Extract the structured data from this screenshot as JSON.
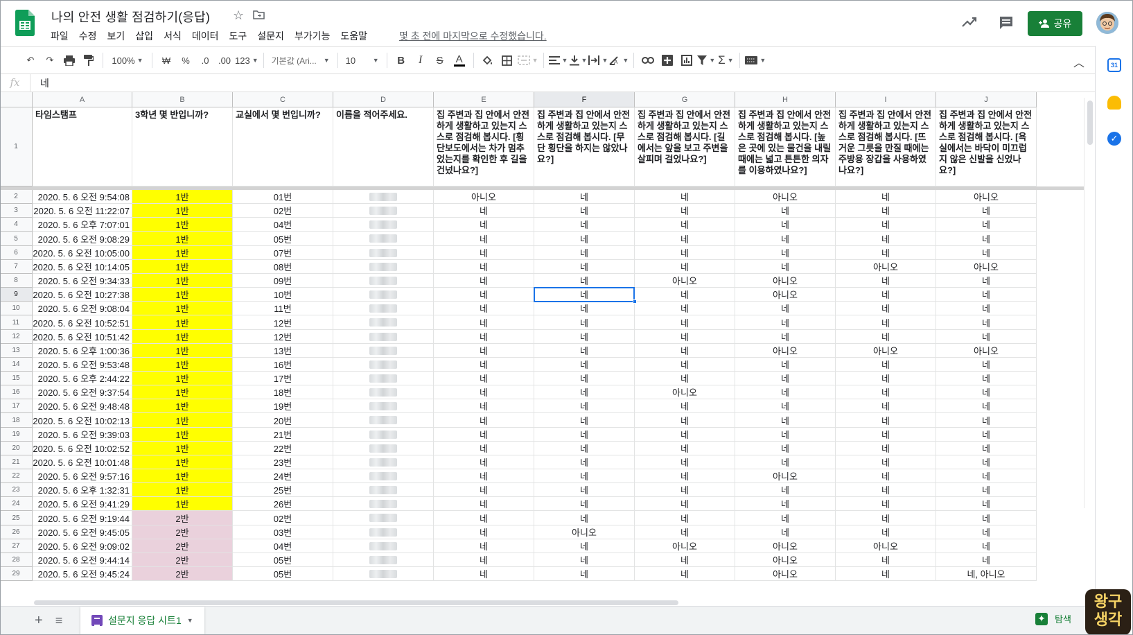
{
  "app": {
    "title": "나의 안전 생활 점검하기(응답)",
    "last_edit": "몇 초 전에 마지막으로 수정했습니다.",
    "share_label": "공유",
    "brand_color": "#188038"
  },
  "menu": [
    "파일",
    "수정",
    "보기",
    "삽입",
    "서식",
    "데이터",
    "도구",
    "설문지",
    "부가기능",
    "도움말"
  ],
  "toolbar": {
    "zoom": "100%",
    "currency": "₩",
    "percent": "%",
    "decimal_decrease": ".0",
    "decimal_increase": ".00",
    "format_more": "123",
    "font": "기본값 (Ari...",
    "font_size": "10"
  },
  "formula_bar": {
    "fx": "fx",
    "value": "네"
  },
  "columns": [
    "A",
    "B",
    "C",
    "D",
    "E",
    "F",
    "G",
    "H",
    "I",
    "J"
  ],
  "header_row": {
    "number": "1",
    "cells": [
      "타임스탬프",
      "3학년 몇 반입니까?",
      "교실에서 몇 번입니까?",
      "이름을 적어주세요.",
      "집 주변과 집 안에서 안전하게 생활하고 있는지 스스로 점검해 봅시다. [횡단보도에서는 차가 멈추었는지를 확인한 후 길을 건넜나요?]",
      "집 주변과 집 안에서 안전하게 생활하고 있는지 스스로 점검해 봅시다. [무단 횡단을 하지는 않았나요?]",
      "집 주변과 집 안에서 안전하게 생활하고 있는지 스스로 점검해 봅시다. [길에서는 앞을 보고 주변을 살피며 걸었나요?]",
      "집 주변과 집 안에서 안전하게 생활하고 있는지 스스로 점검해 봅시다. [높은 곳에 있는 물건을 내릴 때에는 넓고 튼튼한 의자를 이용하였나요?]",
      "집 주변과 집 안에서 안전하게 생활하고 있는지 스스로 점검해 봅시다. [뜨거운 그릇을 만질 때에는 주방용 장갑을 사용하였나요?]",
      "집 주변과 집 안에서 안전하게 생활하고 있는지 스스로 점검해 봅시다. [욕실에서는 바닥이 미끄럽지 않은 신발을 신었나요?]"
    ]
  },
  "class_colors": {
    "1반": "#ffff00",
    "2반": "#ead1dc"
  },
  "rows": [
    {
      "n": "2",
      "ts": "2020. 5. 6 오전 9:54:08",
      "cls": "1반",
      "no": "01번",
      "e": "아니오",
      "f": "네",
      "g": "네",
      "h": "아니오",
      "i": "네",
      "j": "아니오"
    },
    {
      "n": "3",
      "ts": "2020. 5. 6 오전 11:22:07",
      "cls": "1반",
      "no": "02번",
      "e": "네",
      "f": "네",
      "g": "네",
      "h": "네",
      "i": "네",
      "j": "네"
    },
    {
      "n": "4",
      "ts": "2020. 5. 6 오후 7:07:01",
      "cls": "1반",
      "no": "04번",
      "e": "네",
      "f": "네",
      "g": "네",
      "h": "네",
      "i": "네",
      "j": "네"
    },
    {
      "n": "5",
      "ts": "2020. 5. 6 오전 9:08:29",
      "cls": "1반",
      "no": "05번",
      "e": "네",
      "f": "네",
      "g": "네",
      "h": "네",
      "i": "네",
      "j": "네"
    },
    {
      "n": "6",
      "ts": "2020. 5. 6 오전 10:05:00",
      "cls": "1반",
      "no": "07번",
      "e": "네",
      "f": "네",
      "g": "네",
      "h": "네",
      "i": "네",
      "j": "네"
    },
    {
      "n": "7",
      "ts": "2020. 5. 6 오전 10:14:05",
      "cls": "1반",
      "no": "08번",
      "e": "네",
      "f": "네",
      "g": "네",
      "h": "네",
      "i": "아니오",
      "j": "아니오"
    },
    {
      "n": "8",
      "ts": "2020. 5. 6 오전 9:34:33",
      "cls": "1반",
      "no": "09번",
      "e": "네",
      "f": "네",
      "g": "아니오",
      "h": "아니오",
      "i": "네",
      "j": "네"
    },
    {
      "n": "9",
      "ts": "2020. 5. 6 오전 10:27:38",
      "cls": "1반",
      "no": "10번",
      "e": "네",
      "f": "네",
      "g": "네",
      "h": "아니오",
      "i": "네",
      "j": "네"
    },
    {
      "n": "10",
      "ts": "2020. 5. 6 오전 9:08:04",
      "cls": "1반",
      "no": "11번",
      "e": "네",
      "f": "네",
      "g": "네",
      "h": "네",
      "i": "네",
      "j": "네"
    },
    {
      "n": "11",
      "ts": "2020. 5. 6 오전 10:52:51",
      "cls": "1반",
      "no": "12번",
      "e": "네",
      "f": "네",
      "g": "네",
      "h": "네",
      "i": "네",
      "j": "네"
    },
    {
      "n": "12",
      "ts": "2020. 5. 6 오전 10:51:42",
      "cls": "1반",
      "no": "12번",
      "e": "네",
      "f": "네",
      "g": "네",
      "h": "네",
      "i": "네",
      "j": "네"
    },
    {
      "n": "13",
      "ts": "2020. 5. 6 오후 1:00:36",
      "cls": "1반",
      "no": "13번",
      "e": "네",
      "f": "네",
      "g": "네",
      "h": "아니오",
      "i": "아니오",
      "j": "아니오"
    },
    {
      "n": "14",
      "ts": "2020. 5. 6 오전 9:53:48",
      "cls": "1반",
      "no": "16번",
      "e": "네",
      "f": "네",
      "g": "네",
      "h": "네",
      "i": "네",
      "j": "네"
    },
    {
      "n": "15",
      "ts": "2020. 5. 6 오후 2:44:22",
      "cls": "1반",
      "no": "17번",
      "e": "네",
      "f": "네",
      "g": "네",
      "h": "네",
      "i": "네",
      "j": "네"
    },
    {
      "n": "16",
      "ts": "2020. 5. 6 오전 9:37:54",
      "cls": "1반",
      "no": "18번",
      "e": "네",
      "f": "네",
      "g": "아니오",
      "h": "네",
      "i": "네",
      "j": "네"
    },
    {
      "n": "17",
      "ts": "2020. 5. 6 오전 9:48:48",
      "cls": "1반",
      "no": "19번",
      "e": "네",
      "f": "네",
      "g": "네",
      "h": "네",
      "i": "네",
      "j": "네"
    },
    {
      "n": "18",
      "ts": "2020. 5. 6 오전 10:02:13",
      "cls": "1반",
      "no": "20번",
      "e": "네",
      "f": "네",
      "g": "네",
      "h": "네",
      "i": "네",
      "j": "네"
    },
    {
      "n": "19",
      "ts": "2020. 5. 6 오전 9:39:03",
      "cls": "1반",
      "no": "21번",
      "e": "네",
      "f": "네",
      "g": "네",
      "h": "네",
      "i": "네",
      "j": "네"
    },
    {
      "n": "20",
      "ts": "2020. 5. 6 오전 10:02:52",
      "cls": "1반",
      "no": "22번",
      "e": "네",
      "f": "네",
      "g": "네",
      "h": "네",
      "i": "네",
      "j": "네"
    },
    {
      "n": "21",
      "ts": "2020. 5. 6 오전 10:01:48",
      "cls": "1반",
      "no": "23번",
      "e": "네",
      "f": "네",
      "g": "네",
      "h": "네",
      "i": "네",
      "j": "네"
    },
    {
      "n": "22",
      "ts": "2020. 5. 6 오전 9:57:16",
      "cls": "1반",
      "no": "24번",
      "e": "네",
      "f": "네",
      "g": "네",
      "h": "아니오",
      "i": "네",
      "j": "네"
    },
    {
      "n": "23",
      "ts": "2020. 5. 6 오후 1:32:31",
      "cls": "1반",
      "no": "25번",
      "e": "네",
      "f": "네",
      "g": "네",
      "h": "네",
      "i": "네",
      "j": "네"
    },
    {
      "n": "24",
      "ts": "2020. 5. 6 오전 9:41:29",
      "cls": "1반",
      "no": "26번",
      "e": "네",
      "f": "네",
      "g": "네",
      "h": "네",
      "i": "네",
      "j": "네"
    },
    {
      "n": "25",
      "ts": "2020. 5. 6 오전 9:19:44",
      "cls": "2반",
      "no": "02번",
      "e": "네",
      "f": "네",
      "g": "네",
      "h": "네",
      "i": "네",
      "j": "네"
    },
    {
      "n": "26",
      "ts": "2020. 5. 6 오전 9:45:05",
      "cls": "2반",
      "no": "03번",
      "e": "네",
      "f": "아니오",
      "g": "네",
      "h": "네",
      "i": "네",
      "j": "네"
    },
    {
      "n": "27",
      "ts": "2020. 5. 6 오전 9:09:02",
      "cls": "2반",
      "no": "04번",
      "e": "네",
      "f": "네",
      "g": "아니오",
      "h": "아니오",
      "i": "아니오",
      "j": "네"
    },
    {
      "n": "28",
      "ts": "2020. 5. 6 오전 9:44:14",
      "cls": "2반",
      "no": "05번",
      "e": "네",
      "f": "네",
      "g": "네",
      "h": "아니오",
      "i": "네",
      "j": "네"
    },
    {
      "n": "29",
      "ts": "2020. 5. 6 오전 9:45:24",
      "cls": "2반",
      "no": "05번",
      "e": "네",
      "f": "네",
      "g": "네",
      "h": "아니오",
      "i": "네",
      "j": "네, 아니오"
    }
  ],
  "selected_cell": {
    "column": "F",
    "row": "9"
  },
  "sheet_tab": {
    "label": "설문지 응답 시트1"
  },
  "explore_label": "탐색",
  "watermark": {
    "line1": "왕구",
    "line2": "생각"
  }
}
